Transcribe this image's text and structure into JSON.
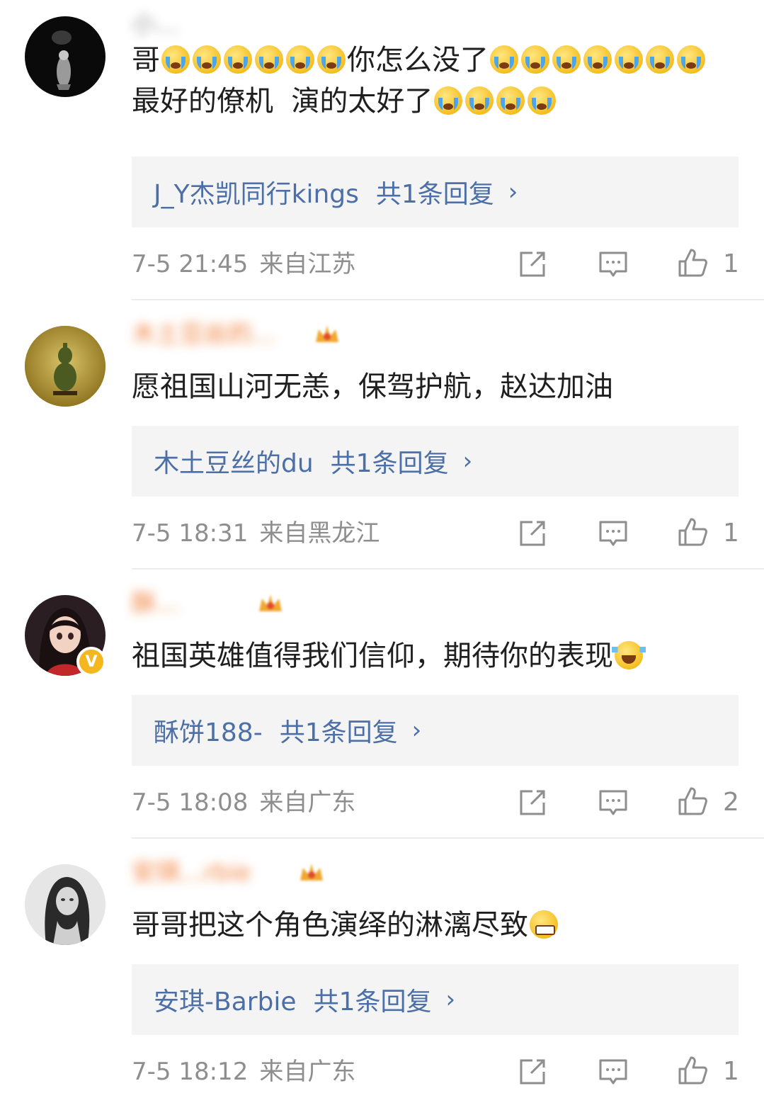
{
  "colors": {
    "link": "#4b6fa6",
    "meta": "#8e8e8e",
    "username": "#ee6b1a",
    "reply_bg": "#f4f4f4"
  },
  "comments": [
    {
      "username": "小…",
      "text_parts": [
        "哥",
        "你怎么没了",
        "最好的僚机  演的太好了"
      ],
      "reply_user": "J_Y杰凯同行kings",
      "reply_count": "共1条回复",
      "time": "7-5 21:45",
      "location": "来自江苏",
      "likes": "1"
    },
    {
      "username": "木土豆丝的…",
      "text": "愿祖国山河无恙，保驾护航，赵达加油",
      "reply_user": "木土豆丝的du",
      "reply_count": "共1条回复",
      "time": "7-5 18:31",
      "location": "来自黑龙江",
      "likes": "1"
    },
    {
      "username": "酥…",
      "text": "祖国英雄值得我们信仰，期待你的表现",
      "reply_user": "酥饼188-",
      "reply_count": "共1条回复",
      "time": "7-5 18:08",
      "location": "来自广东",
      "likes": "2"
    },
    {
      "username": "安琪…rbie",
      "text": "哥哥把这个角色演绎的淋漓尽致",
      "reply_user": "安琪-Barbie",
      "reply_count": "共1条回复",
      "time": "7-5 18:12",
      "location": "来自广东",
      "likes": "1"
    }
  ],
  "icons": {
    "share": "share-icon",
    "comment": "comment-icon",
    "like": "thumbs-up-icon",
    "chevron": "chevron-right-icon"
  }
}
